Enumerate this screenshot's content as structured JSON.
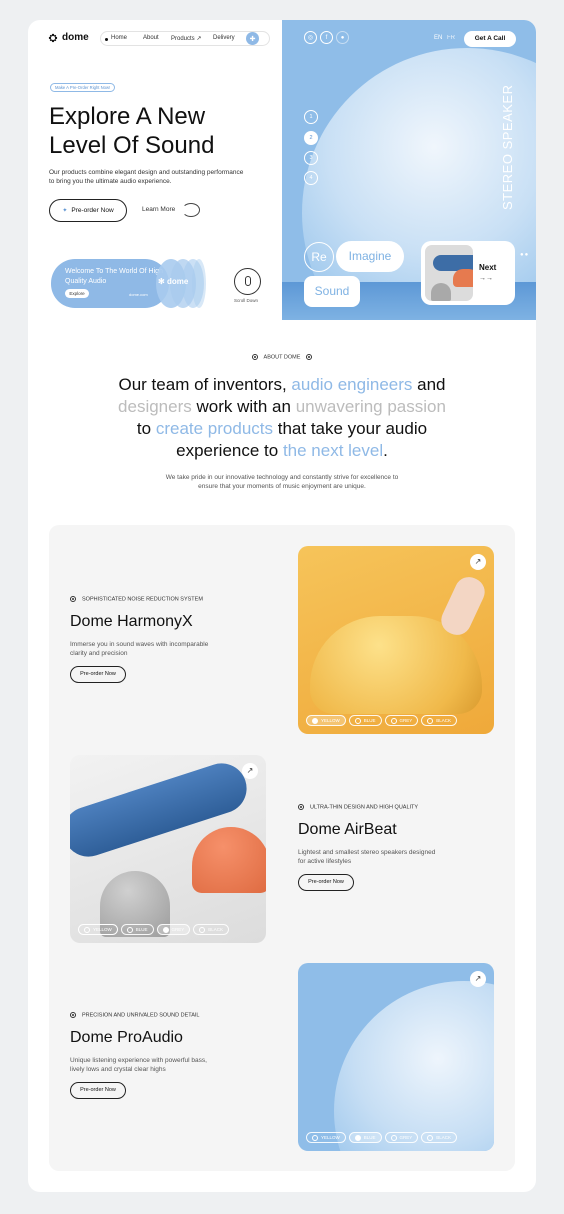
{
  "brand": {
    "name": "dome"
  },
  "nav": {
    "items": [
      "Home",
      "About",
      "Products ↗",
      "Delivery"
    ]
  },
  "header_right": {
    "languages": [
      "EN",
      "FR"
    ],
    "cta": "Get A Call"
  },
  "hero": {
    "tag": "Make A Pre-Order Right Now!",
    "title_lines": [
      "Explore A New",
      "Level Of Sound"
    ],
    "description": "Our products combine elegant design and outstanding performance to bring you the ultimate audio experience.",
    "preorder_label": "Pre-order Now",
    "learn_more_label": "Learn More",
    "promo": {
      "text": "Welcome To The World Of High Quality Audio",
      "explore_label": "Explore",
      "url": "dome.com",
      "logo": "dome"
    },
    "scroll_label": "Scroll Down",
    "slide_numbers": [
      "1",
      "2",
      "3",
      "4"
    ],
    "active_slide": 2,
    "vertical_text": "STEREO SPEAKER",
    "words": [
      "Re",
      "Imagine",
      "Sound"
    ],
    "next_label": "Next"
  },
  "about": {
    "label": "ABOUT DOME",
    "headline": [
      [
        {
          "t": "Our team of inventors, ",
          "c": "dark"
        },
        {
          "t": "audio engineers",
          "c": "blue"
        },
        {
          "t": " and",
          "c": "dark"
        }
      ],
      [
        {
          "t": "designers",
          "c": "grey"
        },
        {
          "t": " work with an ",
          "c": "dark"
        },
        {
          "t": "unwavering passion",
          "c": "grey"
        }
      ],
      [
        {
          "t": "to ",
          "c": "dark"
        },
        {
          "t": "create products",
          "c": "blue"
        },
        {
          "t": " that take your audio",
          "c": "dark"
        }
      ],
      [
        {
          "t": "experience to ",
          "c": "dark"
        },
        {
          "t": "the next level",
          "c": "blue"
        },
        {
          "t": ".",
          "c": "dark"
        }
      ]
    ],
    "paragraph": "We take pride in our innovative technology and constantly strive for excellence to ensure that your moments of music enjoyment are unique."
  },
  "products": [
    {
      "tag": "SOPHISTICATED NOISE REDUCTION SYSTEM",
      "name": "Dome HarmonyX",
      "description": "Immerse you in sound waves with incomparable clarity and precision",
      "cta": "Pre-order Now",
      "colors": [
        "YELLOW",
        "BLUE",
        "GREY",
        "BLACK"
      ],
      "selected_color": "YELLOW"
    },
    {
      "tag": "ULTRA-THIN DESIGN AND HIGH QUALITY",
      "name": "Dome AirBeat",
      "description": "Lightest and smallest stereo speakers designed for active lifestyles",
      "cta": "Pre-order Now",
      "colors": [
        "YELLOW",
        "BLUE",
        "GREY",
        "BLACK"
      ],
      "selected_color": "GREY"
    },
    {
      "tag": "PRECISION AND UNRIVALED SOUND DETAIL",
      "name": "Dome ProAudio",
      "description": "Unique listening experience with powerful bass, lively lows and crystal clear highs",
      "cta": "Pre-order Now",
      "colors": [
        "YELLOW",
        "BLUE",
        "GREY",
        "BLACK"
      ],
      "selected_color": "BLUE"
    }
  ],
  "colors": {
    "accent": "#8fb9e6",
    "yellow": "#f2b74b",
    "dark": "#111111"
  }
}
